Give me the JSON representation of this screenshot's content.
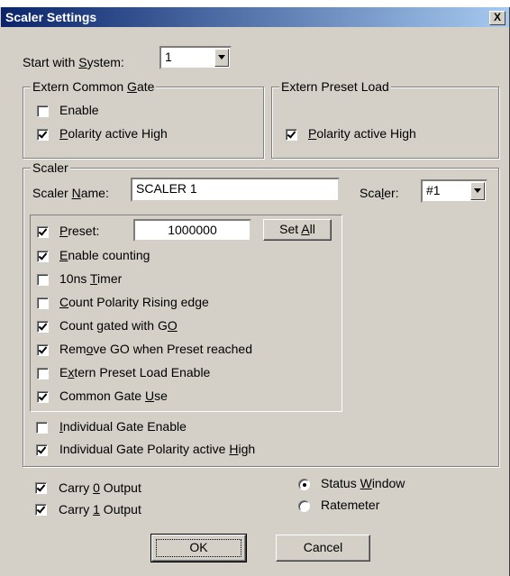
{
  "window": {
    "title": "Scaler Settings",
    "close_label": "X"
  },
  "start_system": {
    "label_pre": "Start with ",
    "label_key": "S",
    "label_post": "ystem:",
    "value": "1"
  },
  "extern_common_gate": {
    "title_pre": "Extern Common ",
    "title_key": "G",
    "title_post": "ate",
    "enable": {
      "label": "Enable",
      "checked": false
    },
    "polarity": {
      "label_key": "P",
      "label_post": "olarity active High",
      "checked": true
    }
  },
  "extern_preset_load": {
    "title": "Extern Preset Load",
    "polarity": {
      "label_key": "P",
      "label_post": "olarity active High",
      "checked": true
    }
  },
  "scaler": {
    "title": "Scaler",
    "name_label_pre": "Scaler ",
    "name_label_key": "N",
    "name_label_post": "ame:",
    "name_value": "SCALER 1",
    "scaler_label_pre": "Sca",
    "scaler_label_key": "l",
    "scaler_label_post": "er:",
    "scaler_value": "#1",
    "preset": {
      "label_pre": "",
      "label_key": "P",
      "label_post": "reset:",
      "value": "1000000",
      "checked": true
    },
    "set_all": {
      "label_pre": "Set ",
      "label_key": "A",
      "label_post": "ll"
    },
    "options": [
      {
        "pre": "",
        "key": "E",
        "post": "nable counting",
        "checked": true
      },
      {
        "pre": "10ns ",
        "key": "T",
        "post": "imer",
        "checked": false
      },
      {
        "pre": "",
        "key": "C",
        "post": "ount Polarity Rising edge",
        "checked": false
      },
      {
        "pre": "Count gated with G",
        "key": "O",
        "post": "",
        "checked": true
      },
      {
        "pre": "Rem",
        "key": "o",
        "post": "ve GO when Preset reached",
        "checked": true
      },
      {
        "pre": "E",
        "key": "x",
        "post": "tern Preset Load Enable",
        "checked": false
      },
      {
        "pre": "Common Gate ",
        "key": "U",
        "post": "se",
        "checked": true
      }
    ],
    "individual": [
      {
        "pre": "",
        "key": "I",
        "post": "ndividual Gate Enable",
        "checked": false
      },
      {
        "pre": "Individual Gate Polarity active ",
        "key": "H",
        "post": "igh",
        "checked": true
      }
    ]
  },
  "carry": [
    {
      "pre": "Carry ",
      "key": "0",
      "post": " Output",
      "checked": true
    },
    {
      "pre": "Carry ",
      "key": "1",
      "post": " Output",
      "checked": true
    }
  ],
  "radios": [
    {
      "pre": "Status ",
      "key": "W",
      "post": "indow",
      "checked": true
    },
    {
      "pre": "Ratemeter",
      "key": "",
      "post": "",
      "checked": false
    }
  ],
  "buttons": {
    "ok": "OK",
    "cancel": "Cancel"
  }
}
